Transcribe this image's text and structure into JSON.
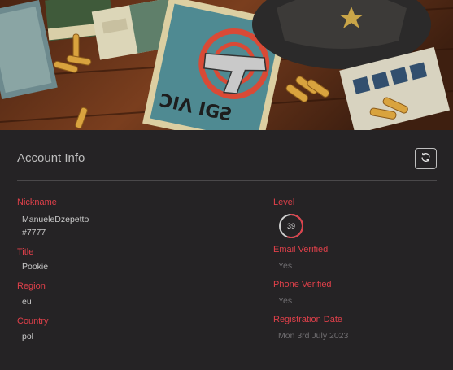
{
  "banner": {
    "image": "wild-west-revolver-poster-banner",
    "poster_text": "ƆΙΛ ΙGƧ"
  },
  "header": {
    "title": "Account Info",
    "refresh_icon": "refresh-icon"
  },
  "fields": {
    "nickname": {
      "label": "Nickname",
      "value": "ManueleDżepetto",
      "tag": "#7777"
    },
    "title": {
      "label": "Title",
      "value": "Pookie"
    },
    "region": {
      "label": "Region",
      "value": "eu"
    },
    "country": {
      "label": "Country",
      "value": "pol"
    },
    "level": {
      "label": "Level",
      "value": "39",
      "progress": 0.55
    },
    "email_verified": {
      "label": "Email Verified",
      "value": "Yes"
    },
    "phone_verified": {
      "label": "Phone Verified",
      "value": "Yes"
    },
    "registration_date": {
      "label": "Registration Date",
      "value": "Mon 3rd July 2023"
    }
  },
  "colors": {
    "label": "#e0404a",
    "panel": "#252325",
    "ring_fill": "#e0404a",
    "ring_track": "#cfcfcf"
  }
}
